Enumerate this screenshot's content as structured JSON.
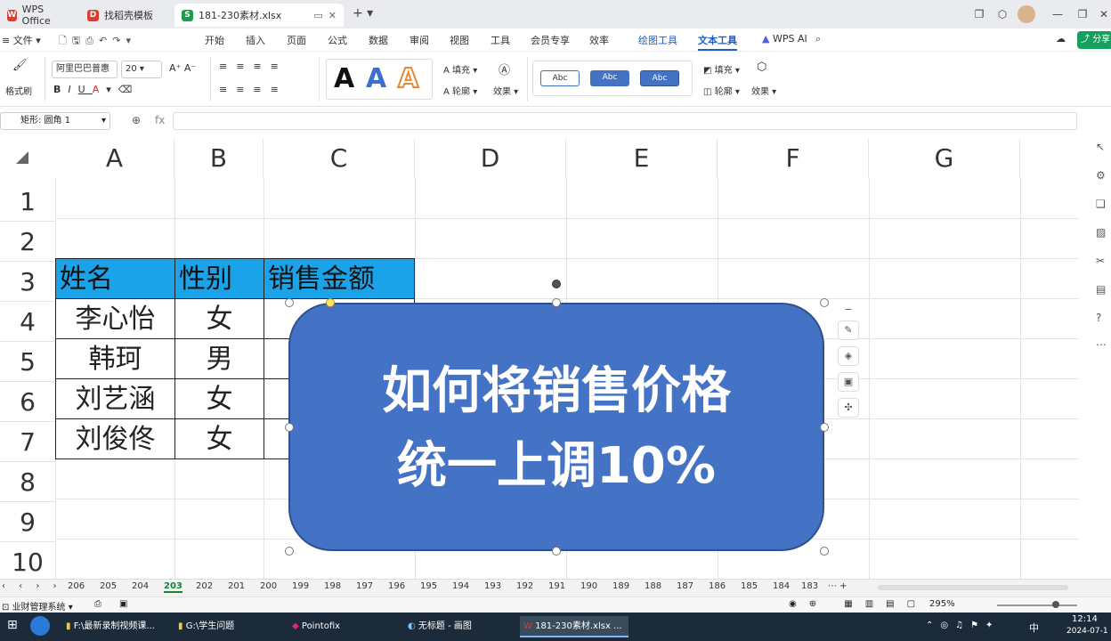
{
  "tabs": [
    {
      "label": "WPS Office"
    },
    {
      "label": "找稻壳模板"
    },
    {
      "label": "181-230素材.xlsx"
    }
  ],
  "menus": [
    "文件",
    "开始",
    "插入",
    "页面",
    "公式",
    "数据",
    "审阅",
    "视图",
    "工具",
    "会员专享",
    "效率",
    "绘图工具",
    "文本工具",
    "WPS AI"
  ],
  "ribbon": {
    "format_painter": "格式刷",
    "font_name": "阿里巴巴普惠",
    "font_size": "20",
    "fill": "填充",
    "outline": "轮廓",
    "effects": "效果",
    "fill2": "填充",
    "outline2": "轮廓",
    "effects2": "效果",
    "style_sample": "Abc",
    "share": "分享"
  },
  "formula_bar": {
    "name_box": "矩形: 圆角 1",
    "fx": "fx"
  },
  "columns": [
    "A",
    "B",
    "C",
    "D",
    "E",
    "F",
    "G"
  ],
  "rows": [
    "1",
    "2",
    "3",
    "4",
    "5",
    "6",
    "7",
    "8",
    "9",
    "10"
  ],
  "table": {
    "headers": [
      "姓名",
      "性别",
      "销售金额"
    ],
    "rows": [
      [
        "李心怡",
        "女"
      ],
      [
        "韩珂",
        "男"
      ],
      [
        "刘艺涵",
        "女"
      ],
      [
        "刘俊佟",
        "女"
      ]
    ]
  },
  "shape": {
    "line1": "如何将销售价格",
    "line2": "统一上调10%",
    "fill_color": "#4472c4"
  },
  "sheets": [
    "206",
    "205",
    "204",
    "203",
    "202",
    "201",
    "200",
    "199",
    "198",
    "197",
    "196",
    "195",
    "194",
    "193",
    "192",
    "191",
    "190",
    "189",
    "188",
    "187",
    "186",
    "185",
    "184",
    "183"
  ],
  "active_sheet": "203",
  "status": {
    "left": "业财管理系统",
    "zoom": "295%"
  },
  "taskbar": {
    "items": [
      "F:\\最新录制视频课...",
      "G:\\学生问题",
      "Pointofix",
      "无标题 - 画图",
      "181-230素材.xlsx ..."
    ],
    "time": "12:14",
    "date": "2024-07-1",
    "ime": "中"
  }
}
